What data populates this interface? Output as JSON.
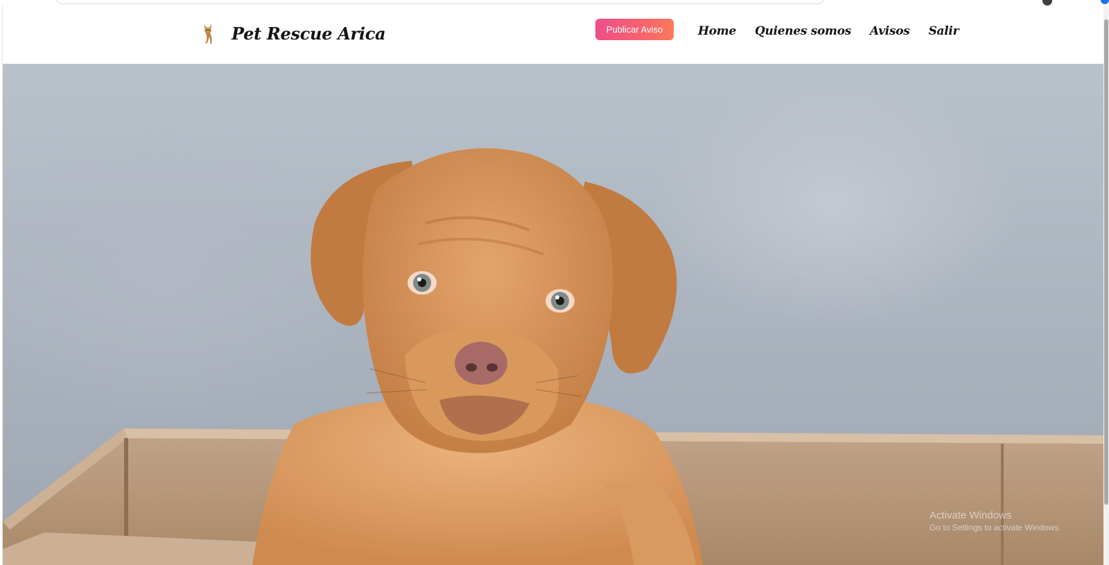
{
  "navbar": {
    "brand_name": "Pet Rescue Arica",
    "publish_button": "Publicar Aviso",
    "links": [
      {
        "label": "Home"
      },
      {
        "label": "Quienes somos"
      },
      {
        "label": "Avisos"
      },
      {
        "label": "Salir"
      }
    ]
  },
  "colors": {
    "button_gradient_start": "#ee4f8a",
    "button_gradient_end": "#fb7a5b",
    "text": "#141414"
  },
  "hero": {
    "image_icon": "puppy-photo"
  },
  "watermark": {
    "title": "Activate Windows",
    "subtitle": "Go to Settings to activate Windows."
  }
}
